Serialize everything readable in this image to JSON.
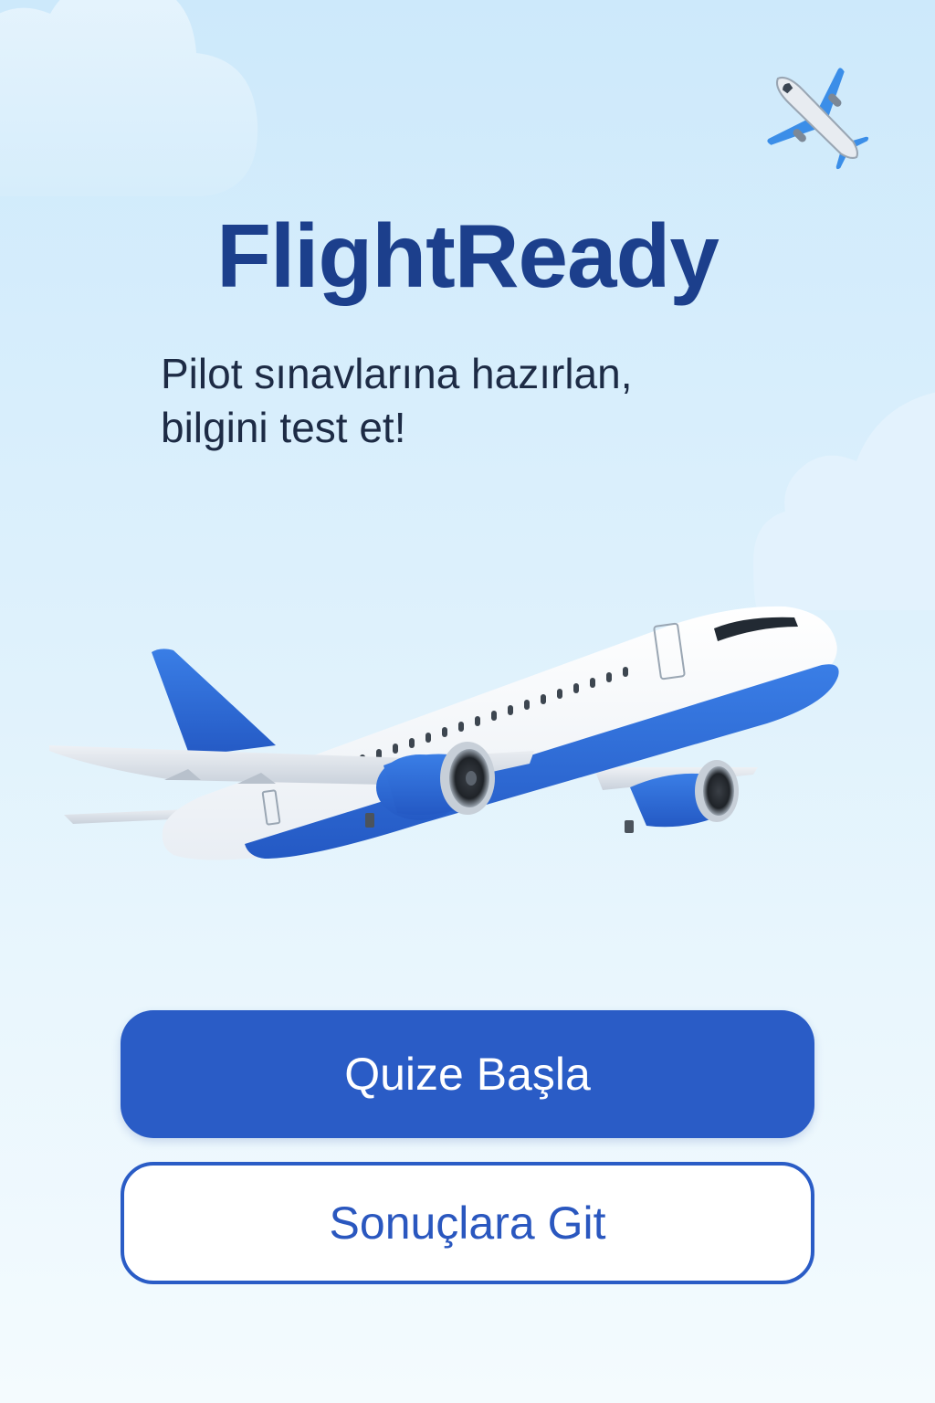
{
  "app": {
    "title": "FlightReady",
    "subtitle_lines": [
      "Pilot sınavlarına hazırlan,",
      "bilgini test et!"
    ]
  },
  "icons": {
    "corner": "airplane-icon",
    "hero": "airplane-illustration"
  },
  "buttons": {
    "start_quiz": "Quize Başla",
    "go_results": "Sonuçlara Git"
  },
  "colors": {
    "title": "#1c3f8c",
    "primary": "#2a5cc6",
    "secondary_text": "#2a57bf",
    "plane_blue": "#2f6fd6"
  }
}
